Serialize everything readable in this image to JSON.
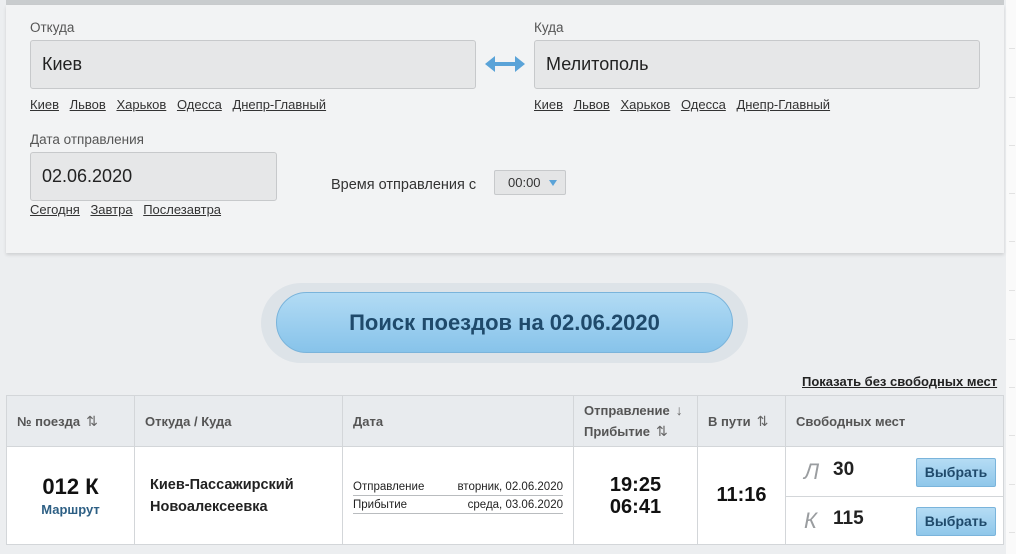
{
  "from": {
    "label": "Откуда",
    "value": "Киев",
    "quick": [
      "Киев",
      "Львов",
      "Харьков",
      "Одесса",
      "Днепр-Главный"
    ]
  },
  "to": {
    "label": "Куда",
    "value": "Мелитополь",
    "quick": [
      "Киев",
      "Львов",
      "Харьков",
      "Одесса",
      "Днепр-Главный"
    ]
  },
  "date": {
    "label": "Дата отправления",
    "value": "02.06.2020",
    "quick": [
      "Сегодня",
      "Завтра",
      "Послезавтра"
    ]
  },
  "time": {
    "label": "Время отправления с",
    "value": "00:00"
  },
  "search_button": "Поиск поездов на 02.06.2020",
  "show_all_link": "Показать без свободных мест",
  "table": {
    "headers": {
      "train": "№ поезда",
      "route": "Откуда / Куда",
      "date": "Дата",
      "departure": "Отправление",
      "arrival": "Прибытие",
      "travel": "В пути",
      "seats": "Свободных мест"
    },
    "rows": [
      {
        "number": "012 К",
        "route_link": "Маршрут",
        "from_station": "Киев-Пассажирский",
        "to_station": "Новоалексеевка",
        "dep_label": "Отправление",
        "dep_date": "вторник, 02.06.2020",
        "arr_label": "Прибытие",
        "arr_date": "среда, 03.06.2020",
        "dep_time": "19:25",
        "arr_time": "06:41",
        "duration": "11:16",
        "seats": [
          {
            "class": "Л",
            "count": "30",
            "button": "Выбрать"
          },
          {
            "class": "К",
            "count": "115",
            "button": "Выбрать"
          }
        ]
      }
    ]
  },
  "colors": {
    "accent": "#87c3ea",
    "button_text": "#1f4a6b",
    "swap_arrow": "#5aa3d8"
  }
}
